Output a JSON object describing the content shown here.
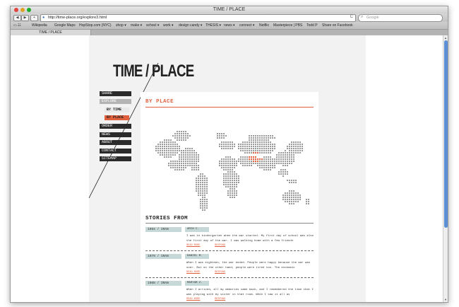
{
  "window": {
    "title": "TIME / PLACE"
  },
  "toolbar": {
    "back": "◀",
    "forward": "▶",
    "add": "+",
    "url": "http://time-place.org/explore3.html",
    "reload": "C",
    "search_placeholder": "Google"
  },
  "bookmarks": [
    "Wikipedia",
    "Google Maps",
    "HopStop.com (NYC)",
    "shop ▾",
    "make ▾",
    "school ▾",
    "work ▾",
    "design candy ▾",
    "THESIS ▾",
    "news ▾",
    "connect ▾",
    "Netflix",
    "Masterpiece | PBS",
    "Todd P",
    "Share on Facebook"
  ],
  "tab": {
    "label": "TIME / PLACE"
  },
  "site": {
    "logo": "TIME / PLACE",
    "menu": {
      "share": "SHARE",
      "explore": "EXPLORE",
      "by_time": "BY TIME",
      "by_place": "BY PLACE",
      "order": "ORDER",
      "news": "NEWS",
      "about": "ABOUT",
      "contact": "CONTACT",
      "sitemap": "SITEMAP"
    },
    "by_place_heading": "BY PLACE",
    "stories_heading": "STORIES FROM",
    "highlight_color": "#e0603e",
    "stories": [
      {
        "date": "1994 / IRAN",
        "name": "ARIN C.",
        "text": "I was in kindergarten when the war started. My first day of school was also the first day of the war. I was walking home with a few friends",
        "read_more": "READ MORE",
        "respond": "RESPOND"
      },
      {
        "date": "1979 / IRAN",
        "name": "DANIEL M.",
        "text": "When I was eighteen, the war ended. People were happy because the war was over. But on the other hand, people were tired too. The economic",
        "read_more": "READ MORE",
        "respond": "RESPOND"
      },
      {
        "date": "1988 / IRAN",
        "name": "MARYAM Z.",
        "text": "When I arrived, all my memories came back, and I remembered the time that I was playing with my sister in that room. When I saw it all as",
        "read_more": "READ MORE",
        "respond": "RESPOND"
      }
    ]
  }
}
